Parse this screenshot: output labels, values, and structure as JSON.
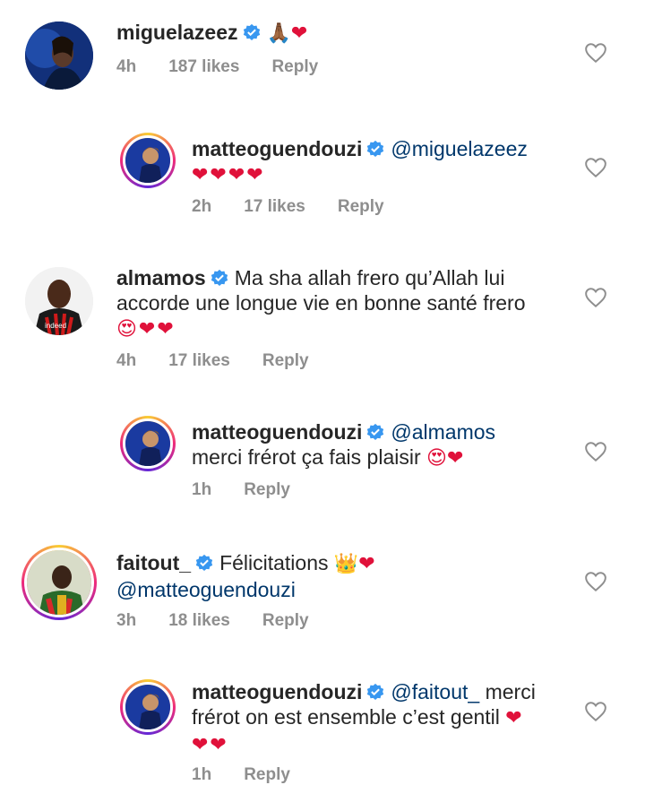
{
  "comments": [
    {
      "username": "miguelazeez",
      "text": "",
      "emoji": "🙏🏾❤",
      "time": "4h",
      "likes": "187 likes",
      "reply": "Reply"
    },
    {
      "username": "matteoguendouzi",
      "mention": "@miguelazeez",
      "emoji": "❤❤❤❤",
      "time": "2h",
      "likes": "17 likes",
      "reply": "Reply"
    },
    {
      "username": "almamos",
      "text_line1": "Ma sha allah frero qu’Allah lui",
      "text_line2": "accorde une longue vie en bonne santé frero",
      "emoji": "😍❤❤",
      "time": "4h",
      "likes": "17 likes",
      "reply": "Reply"
    },
    {
      "username": "matteoguendouzi",
      "mention": "@almamos",
      "text": "merci frérot ça fais plaisir",
      "emoji": "😍❤",
      "time": "1h",
      "reply": "Reply"
    },
    {
      "username": "faitout_",
      "text": "Félicitations",
      "emoji": "👑❤",
      "mention": "@matteoguendouzi",
      "time": "3h",
      "likes": "18 likes",
      "reply": "Reply"
    },
    {
      "username": "matteoguendouzi",
      "mention": "@faitout_",
      "text_line1": "merci",
      "text_line2": "frérot on est ensemble c’est gentil",
      "emoji_inline": "❤",
      "emoji": "❤❤",
      "time": "1h",
      "reply": "Reply"
    }
  ],
  "icons": {
    "verified": "verified-badge-icon",
    "like": "heart-outline-icon"
  }
}
